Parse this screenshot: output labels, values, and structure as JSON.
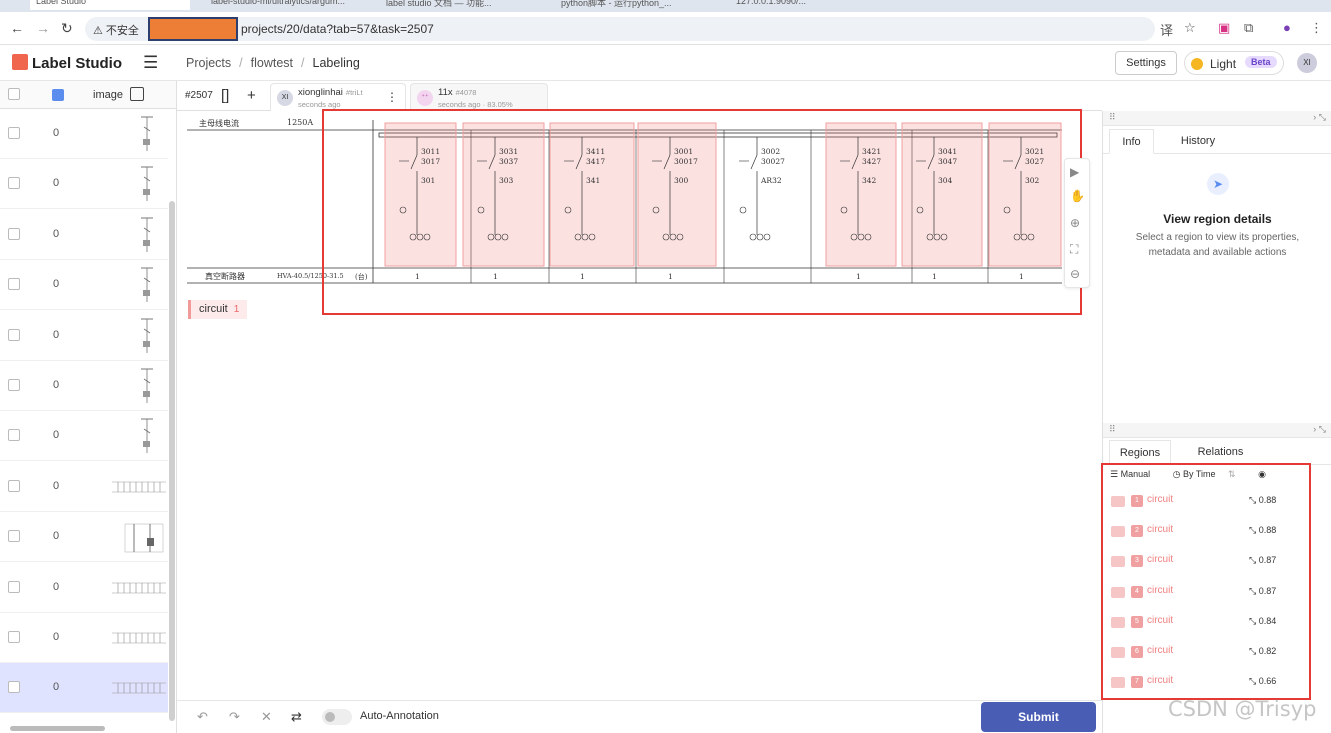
{
  "browser": {
    "tabs": [
      "Label Studio",
      "label-studio-ml/ultralytics/argum...",
      "label studio 文档 — 功能...",
      "python脚本 - 运行python_...",
      "127.0.0.1:9090/..."
    ],
    "security_label": "⚠ 不安全",
    "url": "projects/20/data?tab=57&task=2507"
  },
  "app": {
    "logo": "Label Studio",
    "breadcrumbs": [
      "Projects",
      "flowtest",
      "Labeling"
    ],
    "settings_label": "Settings",
    "theme_label": "Light",
    "beta_label": "Beta",
    "user_initials": "XI"
  },
  "tasklist": {
    "column_label": "image",
    "rows": [
      {
        "value": "0"
      },
      {
        "value": "0"
      },
      {
        "value": "0"
      },
      {
        "value": "0"
      },
      {
        "value": "0"
      },
      {
        "value": "0"
      },
      {
        "value": "0"
      },
      {
        "value": "0"
      },
      {
        "value": "0"
      },
      {
        "value": "0"
      },
      {
        "value": "0"
      },
      {
        "value": "0"
      }
    ]
  },
  "annotation": {
    "task_id": "#2507",
    "annotator_initials": "XI",
    "annotator_name": "xionglinhai",
    "annotator_id": "#triLt",
    "annotator_time": "seconds ago",
    "prediction_name": "11x",
    "prediction_id": "#4078",
    "prediction_meta": "seconds ago · 83.05%"
  },
  "canvas": {
    "top_row_label": "主母线电流",
    "top_row_value": "1250A",
    "bottom_row_label": "真空断路器",
    "bottom_row_spec": "HVA-40.5/1250-31.5",
    "bottom_row_unit": "(台)",
    "panels": [
      {
        "codes": [
          "3011",
          "3017",
          "301"
        ],
        "counts": "1"
      },
      {
        "codes": [
          "3031",
          "3037",
          "303"
        ],
        "counts": "1"
      },
      {
        "codes": [
          "3411",
          "3417",
          "341"
        ],
        "counts": "1"
      },
      {
        "codes": [
          "3001",
          "30017",
          "300"
        ],
        "counts": "1"
      },
      {
        "codes": [
          "3002",
          "30027",
          "AR32"
        ],
        "counts": ""
      },
      {
        "codes": [
          "3421",
          "3427",
          "342"
        ],
        "counts": "1"
      },
      {
        "codes": [
          "3041",
          "3047",
          "304"
        ],
        "counts": "1"
      },
      {
        "codes": [
          "3021",
          "3027",
          "302"
        ],
        "counts": "1"
      }
    ],
    "label_chip": "circuit",
    "label_count": "1"
  },
  "bottom": {
    "auto_annotation_label": "Auto-Annotation",
    "submit_label": "Submit"
  },
  "right": {
    "tab_info": "Info",
    "tab_history": "History",
    "empty_title": "View region details",
    "empty_sub": "Select a region to view its properties, metadata and available actions",
    "tab_regions": "Regions",
    "tab_relations": "Relations",
    "sort_manual": "Manual",
    "sort_time": "By Time",
    "regions": [
      {
        "idx": "1",
        "label": "circuit",
        "score": "0.88"
      },
      {
        "idx": "2",
        "label": "circuit",
        "score": "0.88"
      },
      {
        "idx": "3",
        "label": "circuit",
        "score": "0.87"
      },
      {
        "idx": "4",
        "label": "circuit",
        "score": "0.87"
      },
      {
        "idx": "5",
        "label": "circuit",
        "score": "0.84"
      },
      {
        "idx": "6",
        "label": "circuit",
        "score": "0.82"
      },
      {
        "idx": "7",
        "label": "circuit",
        "score": "0.66"
      }
    ]
  },
  "watermark": "CSDN @Trisyp",
  "colors": {
    "accent": "#4a5db5",
    "region": "#f08080",
    "highlight_box": "#e53935"
  }
}
